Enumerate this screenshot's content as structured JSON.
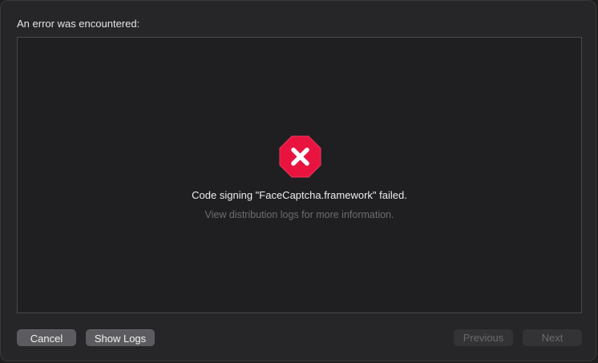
{
  "sheet": {
    "heading": "An error was encountered:"
  },
  "error": {
    "icon": "error-octagon-icon",
    "icon_color": "#e8133f",
    "title": "Code signing \"FaceCaptcha.framework\" failed.",
    "subtitle": "View distribution logs for more information."
  },
  "buttons": {
    "cancel": "Cancel",
    "show_logs": "Show Logs",
    "previous": "Previous",
    "next": "Next"
  }
}
